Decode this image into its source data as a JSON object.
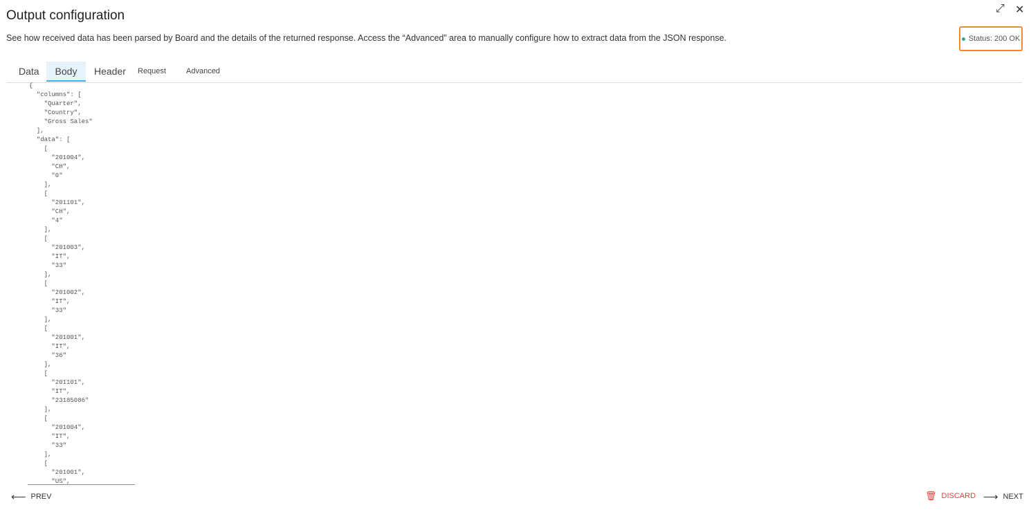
{
  "header": {
    "title": "Output configuration",
    "description": "See how received data has been parsed by Board and the details of the returned response. Access the “Advanced” area to manually configure how to extract data from the JSON response.",
    "status": "Status: 200 OK",
    "status_color": "#3aa874",
    "highlight_color": "#f0892a"
  },
  "tabs": [
    {
      "label": "Data"
    },
    {
      "label": "Body",
      "active": true
    },
    {
      "label": "Header"
    },
    {
      "label": "Request"
    },
    {
      "label": "Advanced"
    }
  ],
  "body_text": "{\n  \"columns\": [\n    \"Quarter\",\n    \"Country\",\n    \"Gross Sales\"\n  ],\n  \"data\": [\n    [\n      \"201004\",\n      \"CH\",\n      \"0\"\n    ],\n    [\n      \"201101\",\n      \"CH\",\n      \"4\"\n    ],\n    [\n      \"201003\",\n      \"IT\",\n      \"33\"\n    ],\n    [\n      \"201002\",\n      \"IT\",\n      \"33\"\n    ],\n    [\n      \"201001\",\n      \"IT\",\n      \"36\"\n    ],\n    [\n      \"201101\",\n      \"IT\",\n      \"23185086\"\n    ],\n    [\n      \"201004\",\n      \"IT\",\n      \"33\"\n    ],\n    [\n      \"201001\",\n      \"US\",",
  "footer": {
    "prev": "PREV",
    "discard": "DISCARD",
    "next": "NEXT",
    "discard_color": "#e0443c"
  }
}
